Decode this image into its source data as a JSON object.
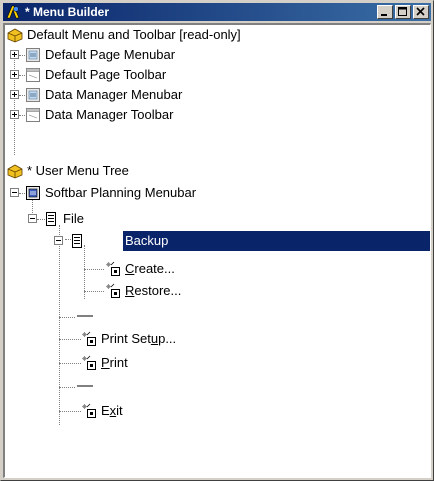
{
  "window": {
    "title": "* Menu Builder"
  },
  "colors": {
    "title_active": "#0a246a",
    "selection": "#0a246a"
  },
  "tree": {
    "default_root": "Default Menu and Toolbar [read-only]",
    "default_items": [
      {
        "label": "Default Page Menubar",
        "icon": "menubar-icon"
      },
      {
        "label": "Default Page Toolbar",
        "icon": "toolbar-icon"
      },
      {
        "label": "Data Manager Menubar",
        "icon": "menubar-icon"
      },
      {
        "label": "Data Manager Toolbar",
        "icon": "toolbar-icon"
      }
    ],
    "user_root": "* User Menu Tree",
    "softbar": "Softbar Planning Menubar",
    "file": "File",
    "backup": "Backup",
    "create": {
      "pre": "",
      "key": "C",
      "post": "reate..."
    },
    "restore": {
      "pre": "",
      "key": "R",
      "post": "estore..."
    },
    "print_setup": {
      "pre": "Print Set",
      "key": "u",
      "post": "p..."
    },
    "print": {
      "pre": "",
      "key": "P",
      "post": "rint"
    },
    "exit": {
      "pre": "E",
      "key": "x",
      "post": "it"
    }
  }
}
